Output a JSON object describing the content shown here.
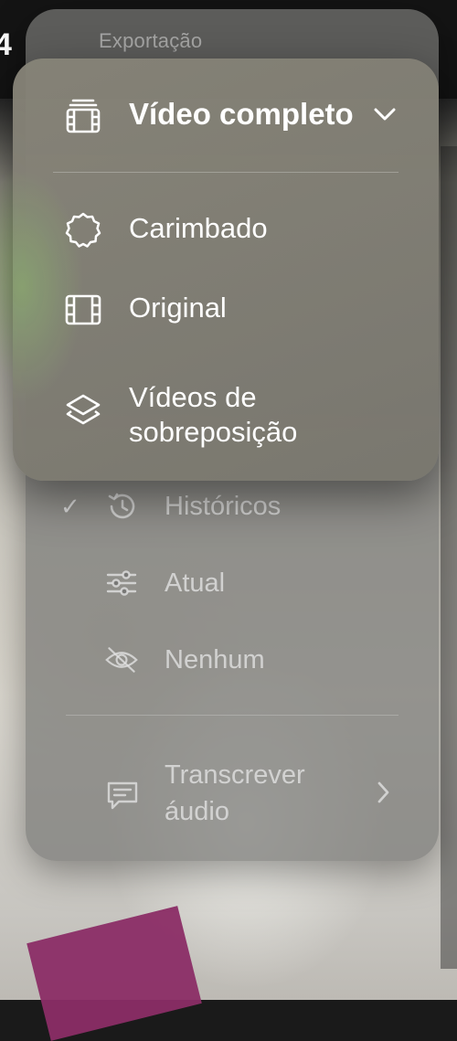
{
  "background": {
    "top_fragment_text": "4"
  },
  "back_menu": {
    "title": "Exportação",
    "items": [
      {
        "label": "Históricos",
        "checked": true,
        "icon": "history-icon"
      },
      {
        "label": "Atual",
        "checked": false,
        "icon": "sliders-icon"
      },
      {
        "label": "Nenhum",
        "checked": false,
        "icon": "eye-slash-icon"
      }
    ],
    "check_mark": "✓",
    "transcribe": {
      "line1": "Transcrever",
      "line2": "áudio",
      "icon": "speech-bubble-icon"
    }
  },
  "front_menu": {
    "header": {
      "label": "Vídeo completo",
      "icon": "film-stack-icon"
    },
    "items": [
      {
        "label": "Carimbado",
        "icon": "badge-seal-icon"
      },
      {
        "label": "Original",
        "icon": "film-icon"
      },
      {
        "label_line1": "Vídeos de",
        "label_line2": "sobreposição",
        "icon": "layers-icon"
      }
    ]
  },
  "colors": {
    "text_primary": "#ffffff",
    "text_dimmed": "#d0d0d0",
    "accent_pink": "#8b2d66"
  }
}
